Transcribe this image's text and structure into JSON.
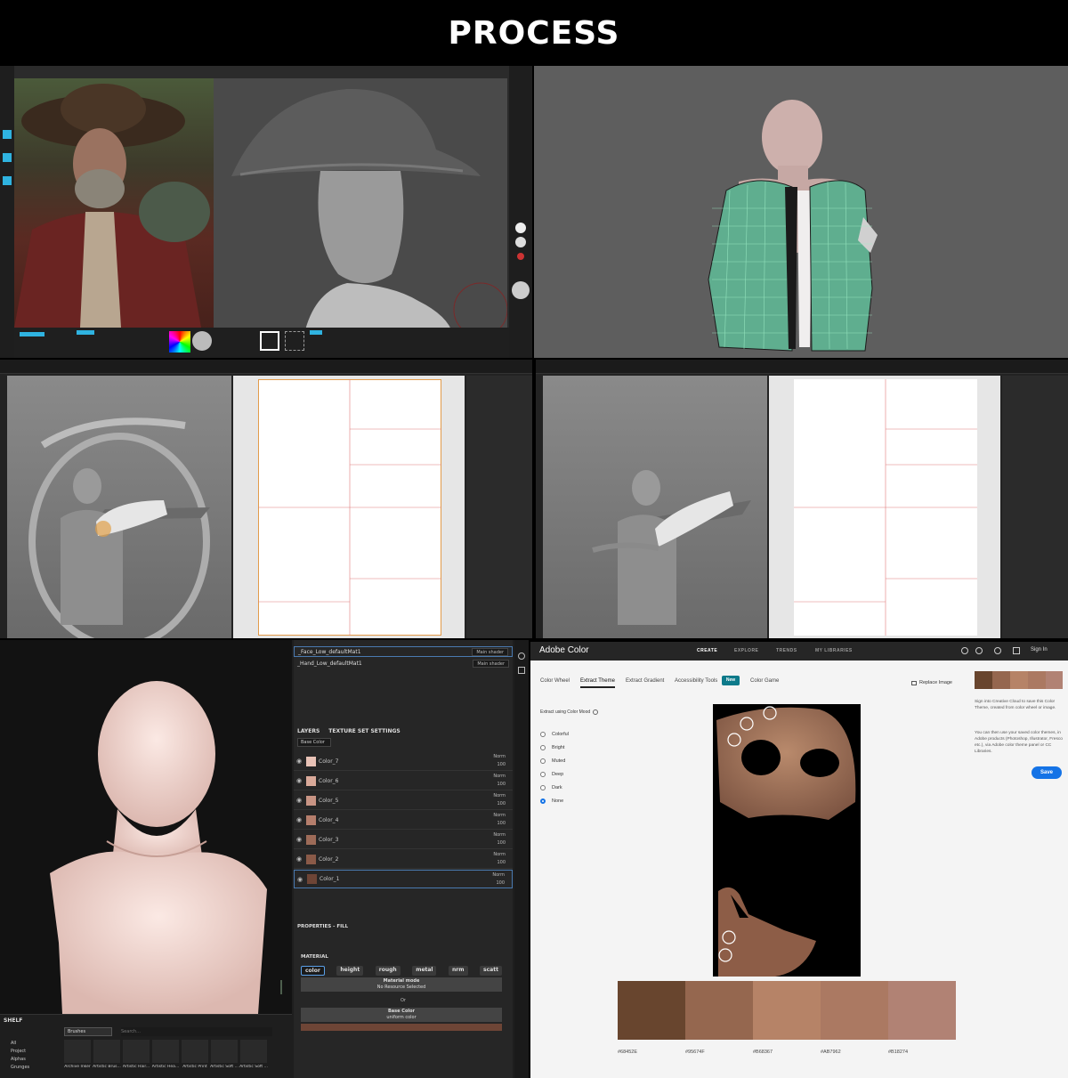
{
  "header": {
    "title": "PROCESS"
  },
  "substance": {
    "materials": [
      {
        "name": "_Face_Low_defaultMat1",
        "shader": "Main shader"
      },
      {
        "name": "_Hand_Low_defaultMat1",
        "shader": "Main shader"
      }
    ],
    "tabs": {
      "layers": "LAYERS",
      "texture_set": "TEXTURE SET SETTINGS"
    },
    "channel_dropdown": "Base Color",
    "layers": [
      {
        "name": "Color_7",
        "blend": "Norm",
        "opacity": "100",
        "color": "#e8c2b6"
      },
      {
        "name": "Color_6",
        "blend": "Norm",
        "opacity": "100",
        "color": "#d9a999"
      },
      {
        "name": "Color_5",
        "blend": "Norm",
        "opacity": "100",
        "color": "#c89484"
      },
      {
        "name": "Color_4",
        "blend": "Norm",
        "opacity": "100",
        "color": "#b57e6c"
      },
      {
        "name": "Color_3",
        "blend": "Norm",
        "opacity": "100",
        "color": "#9d6b58"
      },
      {
        "name": "Color_2",
        "blend": "Norm",
        "opacity": "100",
        "color": "#8a5a48"
      },
      {
        "name": "Color_1",
        "blend": "Norm",
        "opacity": "100",
        "color": "#6e4536"
      }
    ],
    "properties": {
      "title": "PROPERTIES - FILL",
      "material_label": "MATERIAL",
      "channels": [
        "color",
        "height",
        "rough",
        "metal",
        "nrm",
        "scatt"
      ],
      "material_mode": "Material mode",
      "no_resource": "No Resource Selected",
      "or": "Or",
      "base_color": "Base Color",
      "uniform_color": "uniform color",
      "base_swatch": "#6e4536"
    },
    "shelf": {
      "title": "SHELF",
      "categories": [
        "All",
        "Project",
        "Alphas",
        "Grunges"
      ],
      "filter_tag": "Brushes",
      "search_placeholder": "Search...",
      "brushes": [
        "Archive Inker",
        "Artistic Brus...",
        "Artistic Hair...",
        "Artistic Hea...",
        "Artistic Print",
        "Artistic Soft ...",
        "Artistic Soft ..."
      ]
    }
  },
  "adobe": {
    "brand": "Adobe Color",
    "nav": [
      "CREATE",
      "EXPLORE",
      "TRENDS",
      "MY LIBRARIES"
    ],
    "sign_in": "Sign In",
    "tabs": [
      "Color Wheel",
      "Extract Theme",
      "Extract Gradient",
      "Accessibility Tools",
      "Color Game"
    ],
    "new_badge": "New",
    "replace_image": "Replace Image",
    "extract_label": "Extract using Color Mood",
    "moods": [
      "Colorful",
      "Bright",
      "Muted",
      "Deep",
      "Dark",
      "None"
    ],
    "selected_mood": "None",
    "side_text_1": "Sign into Creative Cloud to save this Color Theme, created from color wheel or image.",
    "side_text_2": "You can then use your saved color themes, in Adobe products (Photoshop, Illustrator, Fresco etc.), via Adobe color theme panel or CC Libraries.",
    "save": "Save",
    "swatches": [
      {
        "hex": "#68452E",
        "label": "#68452E"
      },
      {
        "hex": "#95674F",
        "label": "#95674F"
      },
      {
        "hex": "#B68367",
        "label": "#B68367"
      },
      {
        "hex": "#AB7962",
        "label": "#AB7962"
      },
      {
        "hex": "#B18274",
        "label": "#B18274"
      }
    ]
  }
}
